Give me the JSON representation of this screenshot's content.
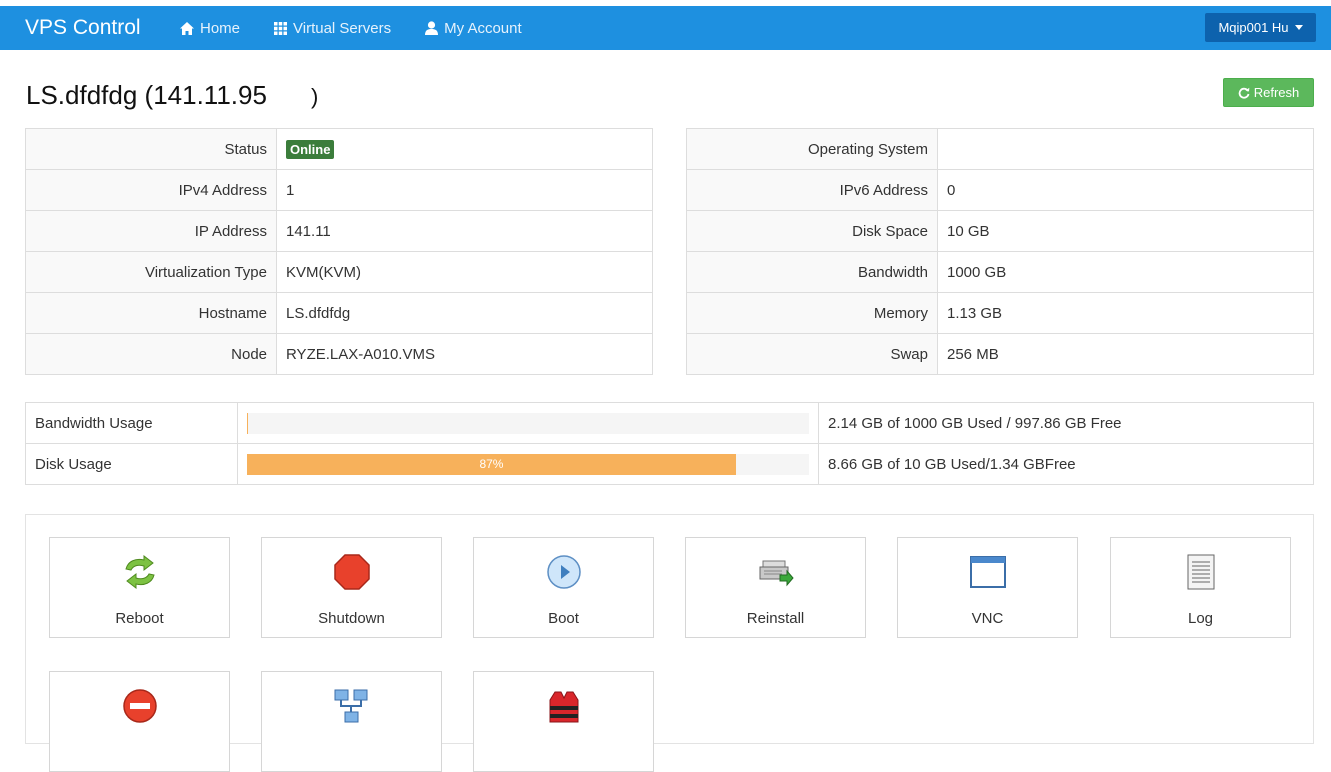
{
  "navbar": {
    "brand": "VPS Control",
    "links": [
      {
        "label": "Home",
        "icon": "home-icon"
      },
      {
        "label": "Virtual Servers",
        "icon": "grid-icon"
      },
      {
        "label": "My Account",
        "icon": "user-icon"
      }
    ],
    "user": "Mqip001 Hu"
  },
  "page": {
    "title": "LS.dfdfdg (141.11.95",
    "title_end": ")",
    "refresh_label": "Refresh"
  },
  "info_left": [
    {
      "label": "Status",
      "value": "Online"
    },
    {
      "label": "IPv4 Address",
      "value": "1"
    },
    {
      "label": "IP Address",
      "value": "141.11"
    },
    {
      "label": "Virtualization Type",
      "value": "KVM(KVM)"
    },
    {
      "label": "Hostname",
      "value": "LS.dfdfdg"
    },
    {
      "label": "Node",
      "value": "RYZE.LAX-A010.VMS"
    }
  ],
  "info_right": [
    {
      "label": "Operating System",
      "value": ""
    },
    {
      "label": "IPv6 Address",
      "value": "0"
    },
    {
      "label": "Disk Space",
      "value": "10 GB"
    },
    {
      "label": "Bandwidth",
      "value": "1000 GB"
    },
    {
      "label": "Memory",
      "value": "1.13 GB"
    },
    {
      "label": "Swap",
      "value": "256 MB"
    }
  ],
  "usage": [
    {
      "label": "Bandwidth Usage",
      "percent": 0.2,
      "percent_label": "",
      "text": "2.14 GB of 1000 GB Used / 997.86 GB Free"
    },
    {
      "label": "Disk Usage",
      "percent": 87,
      "percent_label": "87%",
      "text": "8.66 GB of 10 GB Used/1.34 GBFree"
    }
  ],
  "actions": [
    {
      "label": "Reboot",
      "icon": "reboot-icon"
    },
    {
      "label": "Shutdown",
      "icon": "stop-icon"
    },
    {
      "label": "Boot",
      "icon": "play-icon"
    },
    {
      "label": "Reinstall",
      "icon": "reinstall-icon"
    },
    {
      "label": "VNC",
      "icon": "window-icon"
    },
    {
      "label": "Log",
      "icon": "log-icon"
    },
    {
      "label": "",
      "icon": "no-entry-icon"
    },
    {
      "label": "",
      "icon": "network-icon"
    },
    {
      "label": "",
      "icon": "lifejacket-icon"
    }
  ],
  "colors": {
    "navbar": "#1e90e0",
    "user_button": "#0d62ad",
    "refresh_button": "#5cb85c",
    "online_badge": "#3b7d3b",
    "disk_bar": "#f7b15b"
  }
}
